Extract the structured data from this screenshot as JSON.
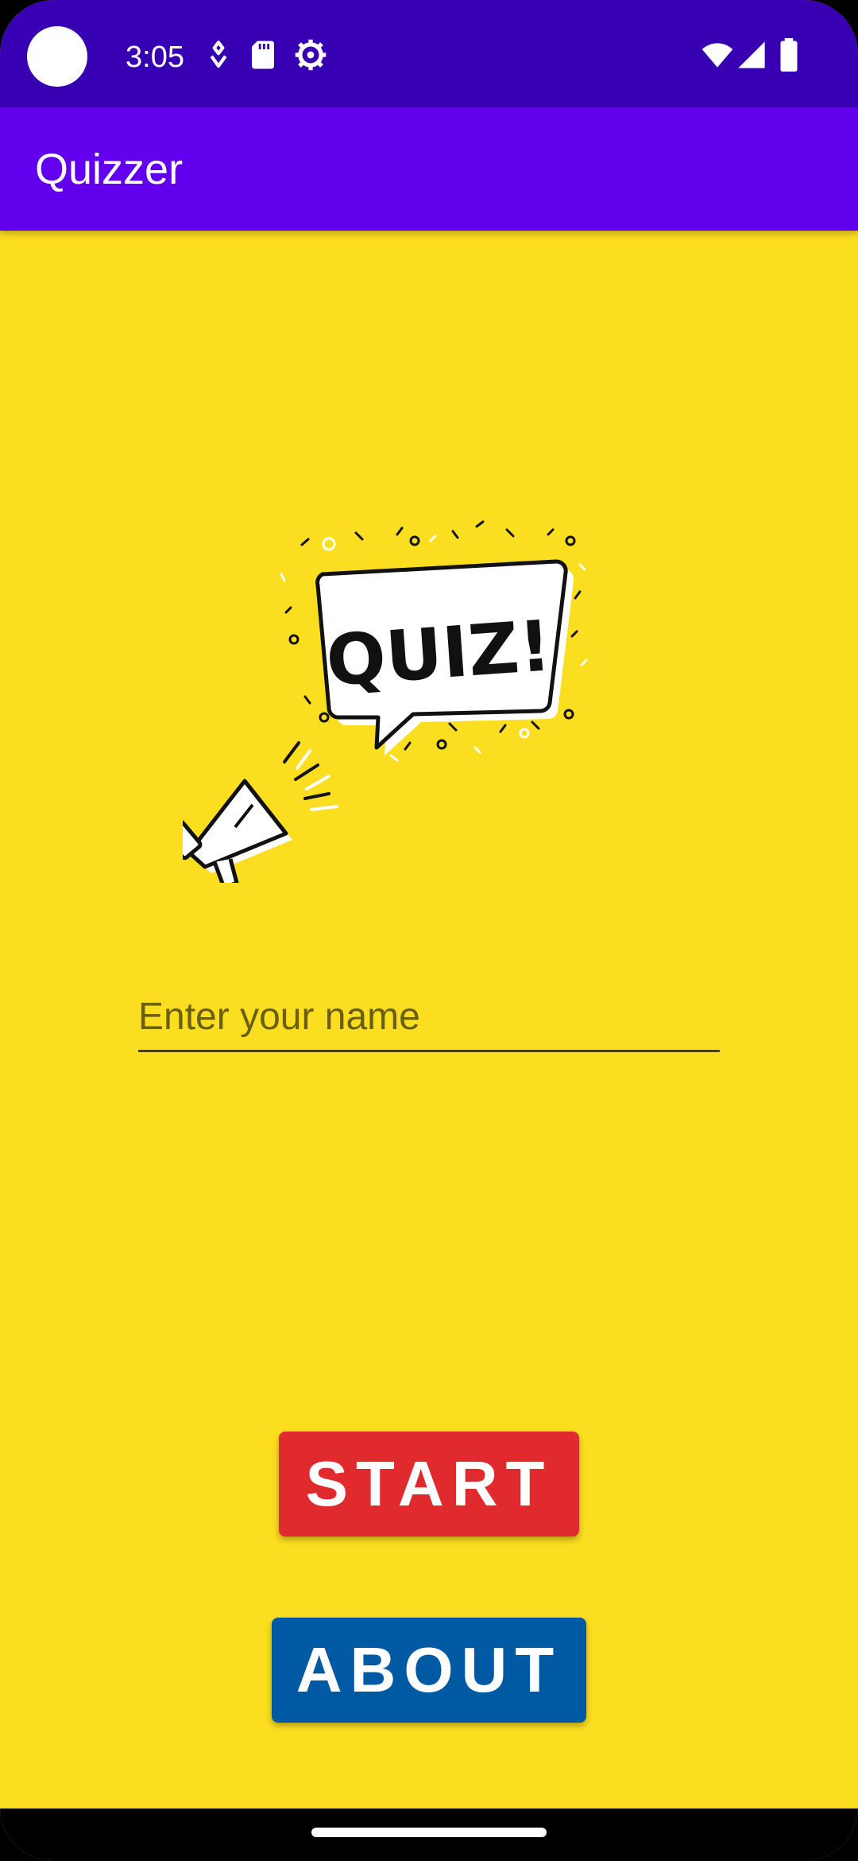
{
  "status_bar": {
    "time": "3:05",
    "icons": [
      "camera-cutout",
      "assistant-icon",
      "sd-card-icon",
      "settings-gear-icon",
      "wifi-icon",
      "signal-icon",
      "battery-icon"
    ]
  },
  "app_bar": {
    "title": "Quizzer"
  },
  "illustration": {
    "text": "QUIZ!",
    "icons": [
      "megaphone-icon",
      "speech-bubble-icon"
    ]
  },
  "name_input": {
    "placeholder": "Enter your name",
    "value": ""
  },
  "buttons": {
    "start_label": "START",
    "about_label": "ABOUT"
  },
  "colors": {
    "status_bar": "#3700b3",
    "app_bar": "#6200ee",
    "background": "#fcde20",
    "start_button": "#e02a2d",
    "about_button": "#0059a3"
  }
}
